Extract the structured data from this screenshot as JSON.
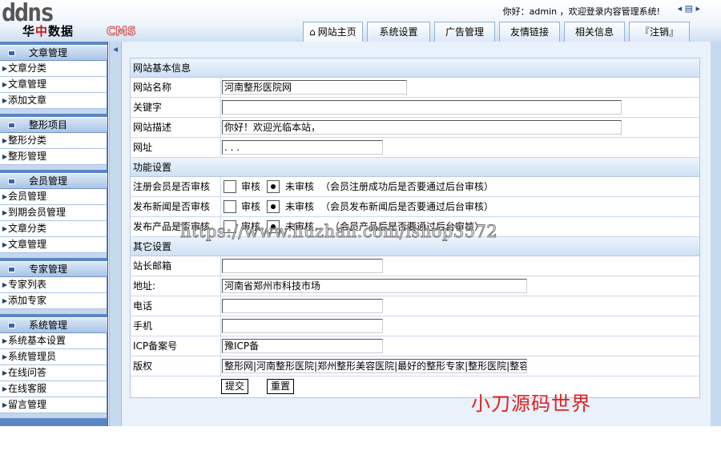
{
  "header": {
    "logo_top": "ddns",
    "logo_cn_1": "华",
    "logo_cn_2": "中",
    "logo_cn_3": "数据",
    "logo_cms": "CMS",
    "greeting": "你好：admin ，欢迎登录内容管理系统!",
    "arrows": "◂ ▤ ▸",
    "tabs": [
      "网站主页",
      "系统设置",
      "广告管理",
      "友情链接",
      "相关信息",
      "『注销』"
    ]
  },
  "sidebar": [
    {
      "title": "文章管理",
      "items": [
        "文章分类",
        "文章管理",
        "添加文章"
      ]
    },
    {
      "title": "整形项目",
      "items": [
        "整形分类",
        "整形管理"
      ]
    },
    {
      "title": "会员管理",
      "items": [
        "会员管理",
        "到期会员管理",
        "文章分类",
        "文章管理"
      ]
    },
    {
      "title": "专家管理",
      "items": [
        "专家列表",
        "添加专家"
      ]
    },
    {
      "title": "系统管理",
      "items": [
        "系统基本设置",
        "系统管理员",
        "在线问答",
        "在线客服",
        "留言管理"
      ]
    }
  ],
  "form": {
    "basic": {
      "title": "网站基本信息",
      "site_name_label": "网站名称",
      "site_name_value": "河南整形医院网",
      "keywords_label": "关键字",
      "keywords_value": "",
      "desc_label": "网站描述",
      "desc_value": "你好！欢迎光临本站，",
      "url_label": "网址",
      "url_value": "    . . ."
    },
    "function": {
      "title": "功能设置",
      "rows": [
        {
          "label": "注册会员是否审核",
          "opt1": "审核",
          "opt2": "未审核",
          "note": "（会员注册成功后是否要通过后台审核）"
        },
        {
          "label": "发布新闻是否审核",
          "opt1": "审核",
          "opt2": "未审核",
          "note": "（会员发布新闻后是否要通过后台审核）"
        },
        {
          "label": "发布产品是否审核",
          "opt1": "审核",
          "opt2": "未审核",
          "note": "（会员产品后是否要通过后台审核）"
        }
      ]
    },
    "other": {
      "title": "其它设置",
      "email_label": "站长邮箱",
      "email_value": "",
      "address_label": "地址:",
      "address_value": "河南省郑州市科技市场",
      "phone_label": "电话",
      "phone_value": "",
      "mobile_label": "手机",
      "mobile_value": "",
      "icp_label": "ICP备案号",
      "icp_value": "豫ICP备",
      "copyright_label": "版权",
      "copyright_value": "整形网|河南整形医院|郑州整形美容医院|最好的整形专家|整形医院|整容"
    },
    "submit_label": "提交",
    "reset_label": "重置"
  },
  "watermark": "https://www.huzhan.com/ishop3572",
  "signature": "小刀源码世界"
}
